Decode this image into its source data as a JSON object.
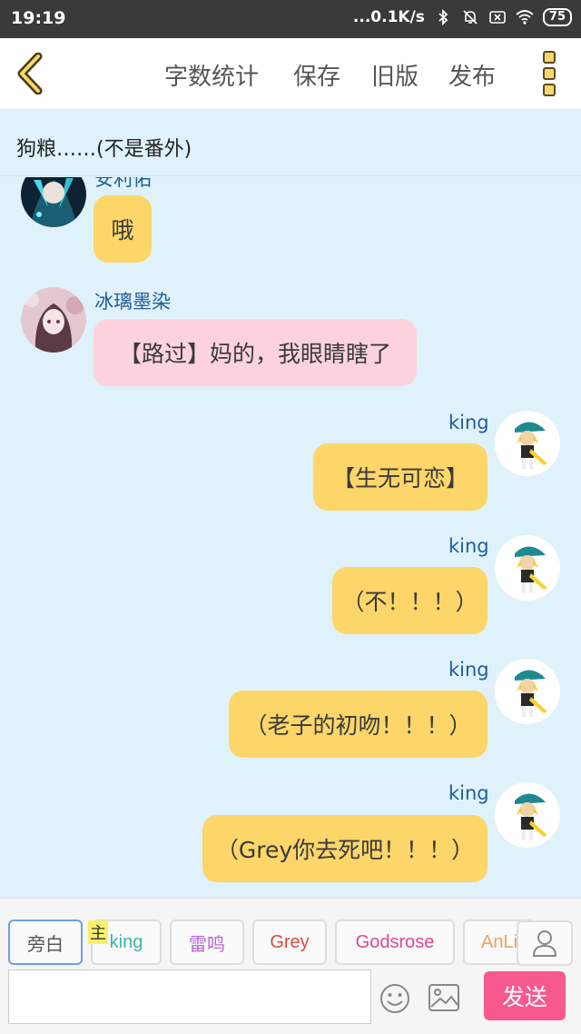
{
  "status_bar": {
    "time": "19:19",
    "network_speed": "...0.1K/s",
    "battery": "75"
  },
  "header": {
    "nav": [
      "字数统计",
      "保存",
      "旧版",
      "发布"
    ]
  },
  "story_title": "狗粮……(不是番外)",
  "messages": [
    {
      "sender": "安利佑",
      "text": "哦",
      "side": "left",
      "color": "yellow"
    },
    {
      "sender": "冰璃墨染",
      "text": "【路过】妈的，我眼睛瞎了",
      "side": "left",
      "color": "pink"
    },
    {
      "sender": "king",
      "text": "【生无可恋】",
      "side": "right",
      "color": "yellow"
    },
    {
      "sender": "king",
      "text": "（不！！！）",
      "side": "right",
      "color": "yellow"
    },
    {
      "sender": "king",
      "text": "（老子的初吻！！！）",
      "side": "right",
      "color": "yellow"
    },
    {
      "sender": "king",
      "text": "（Grey你去死吧！！！）",
      "side": "right",
      "color": "yellow"
    }
  ],
  "roles": [
    {
      "label": "旁白",
      "color": "#555555",
      "active": true
    },
    {
      "label": "king",
      "color": "#3bb5a8",
      "host_badge": "主"
    },
    {
      "label": "雷鸣",
      "color": "#b56bd1"
    },
    {
      "label": "Grey",
      "color": "#d84b3f"
    },
    {
      "label": "Godsrose",
      "color": "#e0488c"
    },
    {
      "label": "AnLi",
      "color": "#f0a057"
    }
  ],
  "composer": {
    "input_value": "",
    "send_label": "发送"
  },
  "colors": {
    "accent": "#f7598f",
    "bubble_yellow": "#fcd669",
    "bubble_pink": "#fcd3dc",
    "chat_bg": "#dff2fb"
  }
}
